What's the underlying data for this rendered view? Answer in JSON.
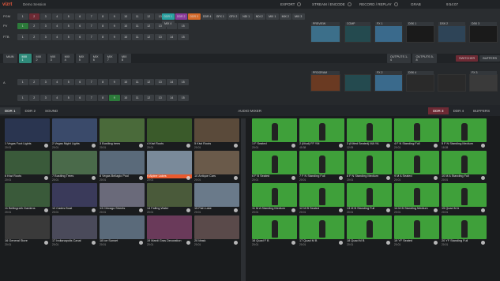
{
  "header": {
    "logo": "vizrt",
    "session": "Demo Session",
    "export": "EXPORT",
    "stream": "STREAM / ENCODE",
    "record": "RECORD / REPLAY",
    "grab": "GRAB",
    "time": "9:54:07"
  },
  "switcher_rows": [
    {
      "label": "PGM",
      "cells": [
        "1",
        "2",
        "3",
        "4",
        "5",
        "6",
        "7",
        "8",
        "9",
        "10",
        "11",
        "12",
        "13",
        "14",
        "15"
      ]
    },
    {
      "label": "PV",
      "cells": [
        "1",
        "2",
        "3",
        "4",
        "5",
        "6",
        "7",
        "8",
        "9",
        "10",
        "11",
        "12",
        "13",
        "14",
        "15"
      ]
    },
    {
      "label": "FTB",
      "cells": [
        "1",
        "2",
        "3",
        "4",
        "5",
        "6",
        "7",
        "8",
        "9",
        "10",
        "11",
        "12",
        "13",
        "14",
        "15"
      ]
    }
  ],
  "ddr_cells": [
    "DDR 1",
    "DDR 2",
    "DDR 3",
    "DDR 4",
    "GFX 1",
    "GFX 2",
    "NDI 1",
    "NDI 2",
    "MIX 1",
    "MIX 2",
    "MIX 3",
    "MIX 4"
  ],
  "monitors": {
    "preview": "PREVIEW",
    "program": "PROGRAM",
    "comp": "COMP",
    "fx1": "FX 1",
    "fx2": "FX 2",
    "fx3": "FX 3",
    "dsk1": "DSK 1",
    "dsk2": "DSK 2",
    "dsk3": "DSK 3",
    "dsk4": "DSK 4"
  },
  "mix_tabs": [
    "MAIN",
    "MIX 1",
    "MIX 2",
    "MIX 3",
    "MIX 4",
    "MIX 5",
    "MIX 6",
    "MIX 7",
    "MIX 8"
  ],
  "outputs": {
    "outputs_a": "OUTPUTS 1-4",
    "outputs_b": "OUTPUTS 5-8",
    "switcher": "SWITCHER",
    "buffers": "BUFFERS"
  },
  "bin_tabs": {
    "ddr1": "DDR 1",
    "ddr2": "DDR 2",
    "sound": "SOUND",
    "audio": "AUDIO MIXER",
    "ddr3": "DDR 3",
    "ddr4": "DDR 4",
    "buffers": "BUFFERS"
  },
  "left_bin": [
    {
      "name": "1 Vegas Foot Lights",
      "d": "20:01"
    },
    {
      "name": "2 Vegas Night Lights",
      "d": "20:01"
    },
    {
      "name": "3 Bustling trees",
      "d": "20:01"
    },
    {
      "name": "4 Kiwi Roots",
      "d": "20:01"
    },
    {
      "name": "5 Kiwi Roots",
      "d": "20:01"
    },
    {
      "name": "6 Kiwi Roots",
      "d": "20:01"
    },
    {
      "name": "7 Bustling Trees",
      "d": "20:01"
    },
    {
      "name": "8 Vegas Bellagio Pool",
      "d": "20:01"
    },
    {
      "name": "9 Alpine Lakes",
      "d": "20:01"
    },
    {
      "name": "10 Antique Cars",
      "d": "20:01"
    },
    {
      "name": "11 Bellingrath Gardens",
      "d": "20:01"
    },
    {
      "name": "12 Cades Boat",
      "d": "20:01"
    },
    {
      "name": "13 Chicago Streets",
      "d": "20:01"
    },
    {
      "name": "14 Falling Water",
      "d": "20:01"
    },
    {
      "name": "15 Fish Lake",
      "d": "20:01"
    },
    {
      "name": "16 General Store",
      "d": "20:01"
    },
    {
      "name": "17 Indianapolis Canal",
      "d": "20:01"
    },
    {
      "name": "18 Ice Sunset",
      "d": "20:01"
    },
    {
      "name": "19 Mardi Gras Decoration",
      "d": "20:01"
    },
    {
      "name": "20 Mask",
      "d": "20:01"
    }
  ],
  "right_bin": [
    {
      "name": "1 F Seated",
      "d": "20:01"
    },
    {
      "name": "2 (Mud) FF YM",
      "d": "45:38"
    },
    {
      "name": "3 (Kilted Seated) MA YA",
      "d": "12:09"
    },
    {
      "name": "4 F N Standing Full",
      "d": "20:01"
    },
    {
      "name": "5 F N Standing Medium",
      "d": "18:28"
    },
    {
      "name": "6 F B Seated",
      "d": "20:01"
    },
    {
      "name": "7 F N Standing Full",
      "d": "20:01"
    },
    {
      "name": "8 F N Standing Medium",
      "d": "20:01"
    },
    {
      "name": "9 M A Seated",
      "d": "20:01"
    },
    {
      "name": "10 M A Standing Full",
      "d": "20:01"
    },
    {
      "name": "11 M A Standing Medium",
      "d": "20:01"
    },
    {
      "name": "12 M B Seated",
      "d": "20:01"
    },
    {
      "name": "13 M B Standing Full",
      "d": "20:01"
    },
    {
      "name": "14 M B Standing Medium",
      "d": "20:01"
    },
    {
      "name": "15 Quad M A",
      "d": "20:01"
    },
    {
      "name": "16 Quad F B",
      "d": "20:01"
    },
    {
      "name": "17 Quad M B",
      "d": "20:01"
    },
    {
      "name": "18 Quad M B",
      "d": "20:01"
    },
    {
      "name": "19 YF Seated",
      "d": "20:01"
    },
    {
      "name": "20 YF Standing Full",
      "d": "20:01"
    }
  ]
}
